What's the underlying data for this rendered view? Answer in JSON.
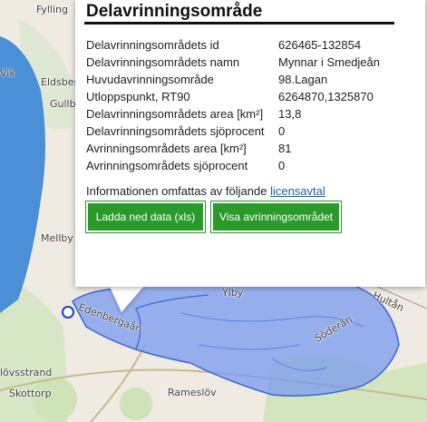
{
  "map": {
    "place_labels": {
      "fylling": "Fylling",
      "vik": "Vik",
      "eldsberga": "Eldsberg",
      "gullbrandstorp": "Gullb",
      "mellby": "Mellby",
      "edenberga": "Edenbergaån",
      "ylby": "Ylby",
      "soderan": "Söderån",
      "hulta": "Hultån",
      "lovstrand": "lövsstrand",
      "skottorp": "Skottorp",
      "ramneslov": "Rameslöv"
    },
    "colors": {
      "water": "#4b8fd6",
      "catchment_fill": "#7a9af0",
      "land": "#efeae2",
      "forest": "#cfe3b8"
    }
  },
  "popup": {
    "title": "Delavrinningsområde",
    "properties": [
      {
        "key": "Delavrinningsområdets id",
        "value": "626465-132854"
      },
      {
        "key": "Delavrinningsområdets namn",
        "value": "Mynnar i Smedjeån"
      },
      {
        "key": "Huvudavrinningsområde",
        "value": "98.Lagan"
      },
      {
        "key": "Utloppspunkt, RT90",
        "value": "6264870,1325870"
      },
      {
        "key": "Delavrinningsområdets area [km²]",
        "value": "13,8"
      },
      {
        "key": "Delavrinningsområdets sjöprocent",
        "value": "0"
      },
      {
        "key": "Avrinningsområdets area [km²]",
        "value": "81"
      },
      {
        "key": "Avrinningsområdets sjöprocent",
        "value": "0"
      }
    ],
    "info_text": "Informationen omfattas av följande ",
    "license_link": "licensavtal",
    "download_button": "Ladda ned data (xls)",
    "show_button": "Visa avrinningsområdet"
  }
}
